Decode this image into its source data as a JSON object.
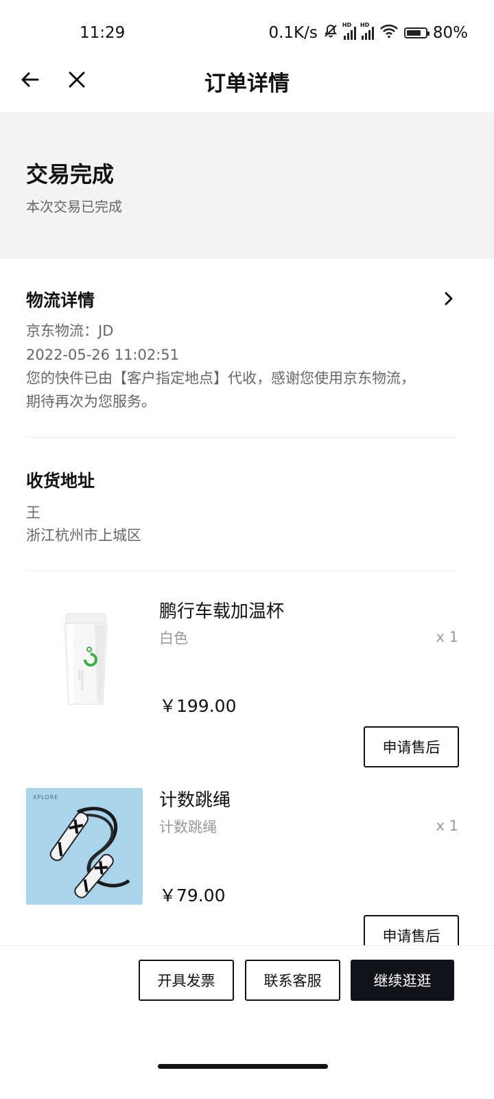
{
  "status_bar": {
    "time": "11:29",
    "network_speed": "0.1K/s",
    "signal_badge": "HD",
    "battery_percent": "80%",
    "battery_level": 0.8
  },
  "nav": {
    "title": "订单详情"
  },
  "order_status": {
    "title": "交易完成",
    "subtitle": "本次交易已完成"
  },
  "logistics": {
    "title": "物流详情",
    "carrier_line": "京东物流：JD",
    "timestamp": "2022-05-26 11:02:51",
    "message_line1": "您的快件已由【客户指定地点】代收，感谢您使用京东物流，",
    "message_line2": "期待再次为您服务。"
  },
  "address": {
    "title": "收货地址",
    "name": "王",
    "location": "浙江杭州市上城区"
  },
  "products": [
    {
      "name": "鹏行车载加温杯",
      "spec": "白色",
      "qty": "x 1",
      "price": "￥199.00",
      "action": "申请售后",
      "image_icon": "thermos-cup-image"
    },
    {
      "name": "计数跳绳",
      "spec": "计数跳绳",
      "qty": "x 1",
      "price": "￥79.00",
      "action": "申请售后",
      "image_icon": "jump-rope-image",
      "image_brand": "XPLORE"
    }
  ],
  "bottom_actions": {
    "invoice": "开具发票",
    "contact": "联系客服",
    "continue": "继续逛逛"
  },
  "colors": {
    "status_bg": "#f4f4f4",
    "primary_dark": "#111318",
    "muted_text": "#666666",
    "light_text": "#999999",
    "accent_green": "#3cb043",
    "product_bg_blue": "#a9d4ea"
  }
}
